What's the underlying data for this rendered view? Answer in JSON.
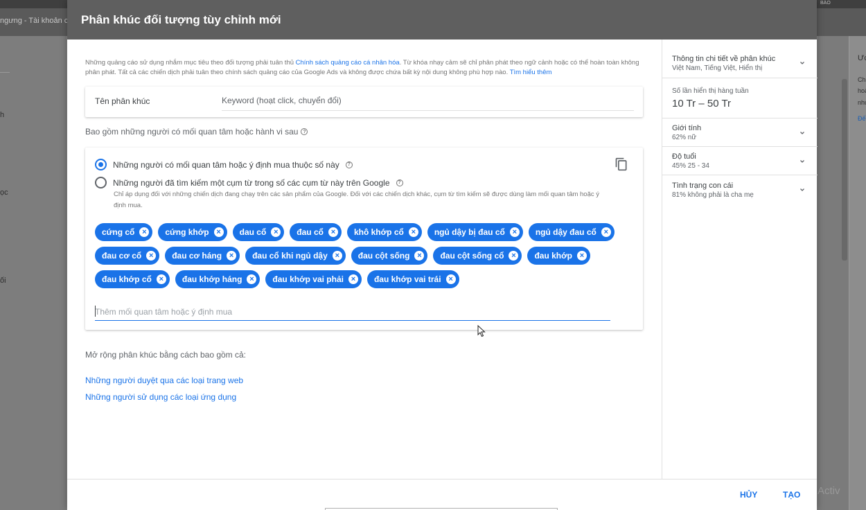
{
  "background": {
    "breadcrumb": "ngưng - Tài khoản cú",
    "top_badge": "BÁO",
    "left_fragments": [
      "h",
      "ọc",
      "ối"
    ],
    "right_fragments": [
      "Ưc",
      "Ch",
      "hoả",
      "như",
      "Đế"
    ],
    "watermark": "Activ"
  },
  "dialog": {
    "title": "Phân khúc đối tượng tùy chỉnh mới",
    "notice": {
      "text_1": "Những quảng cáo sử dụng nhắm mục tiêu theo đối tượng phải tuân thủ ",
      "policy_link": "Chính sách quảng cáo cá nhân hóa",
      "text_2": ". Từ khóa nhạy cảm sẽ chỉ phân phát theo ngữ cảnh hoặc có thể hoàn toàn không phân phát. Tất cả các chiến dịch phải tuân theo chính sách quảng cáo của Google Ads và không được chứa bất kỳ nội dung không phù hợp nào. ",
      "learn_more": "Tìm hiểu thêm"
    },
    "segment_name": {
      "label": "Tên phân khúc",
      "value": "Keyword (hoạt click, chuyển đổi)"
    },
    "include_heading": "Bao gồm những người có mối quan tâm hoặc hành vi sau",
    "options": {
      "interest": "Những người có mối quan tâm hoặc ý định mua thuộc số này",
      "search": "Những người đã tìm kiếm một cụm từ trong số các cụm từ này trên Google",
      "search_note": "Chỉ áp dụng đối với những chiến dịch đang chạy trên các sản phẩm của Google. Đối với các chiến dịch khác, cụm từ tìm kiếm sẽ được dùng làm mối quan tâm hoặc ý định mua."
    },
    "chips": [
      "cứng cổ",
      "cứng khớp",
      "dau cổ",
      "đau cổ",
      "khô khớp cổ",
      "ngủ dậy bị đau cổ",
      "ngủ dậy đau cổ",
      "đau cơ cổ",
      "đau cơ háng",
      "đau cổ khi ngủ dậy",
      "đau cột sống",
      "đau cột sống cổ",
      "đau khớp",
      "đau khớp cổ",
      "đau khớp háng",
      "đau khớp vai phải",
      "đau khớp vai trái"
    ],
    "add_placeholder": "Thêm mối quan tâm hoặc ý định mua",
    "expand_heading": "Mở rộng phân khúc bằng cách bao gồm cả:",
    "expand_links": [
      "Những người duyệt qua các loại trang web",
      "Những người sử dụng các loại ứng dụng"
    ],
    "side": {
      "details_title": "Thông tin chi tiết về phân khúc",
      "details_sub": "Việt Nam, Tiếng Việt, Hiển thị",
      "impressions_title": "Số lần hiển thị hàng tuần",
      "impressions_value": "10 Tr – 50 Tr",
      "gender_title": "Giới tính",
      "gender_value": "62% nữ",
      "age_title": "Độ tuổi",
      "age_value": "45% 25 - 34",
      "parent_title": "Tình trạng con cái",
      "parent_value": "81% không phải là cha mẹ"
    },
    "buttons": {
      "cancel": "HỦY",
      "create": "TẠO"
    }
  },
  "colors": {
    "accent": "#1a73e8",
    "header": "#5f5f5f"
  }
}
